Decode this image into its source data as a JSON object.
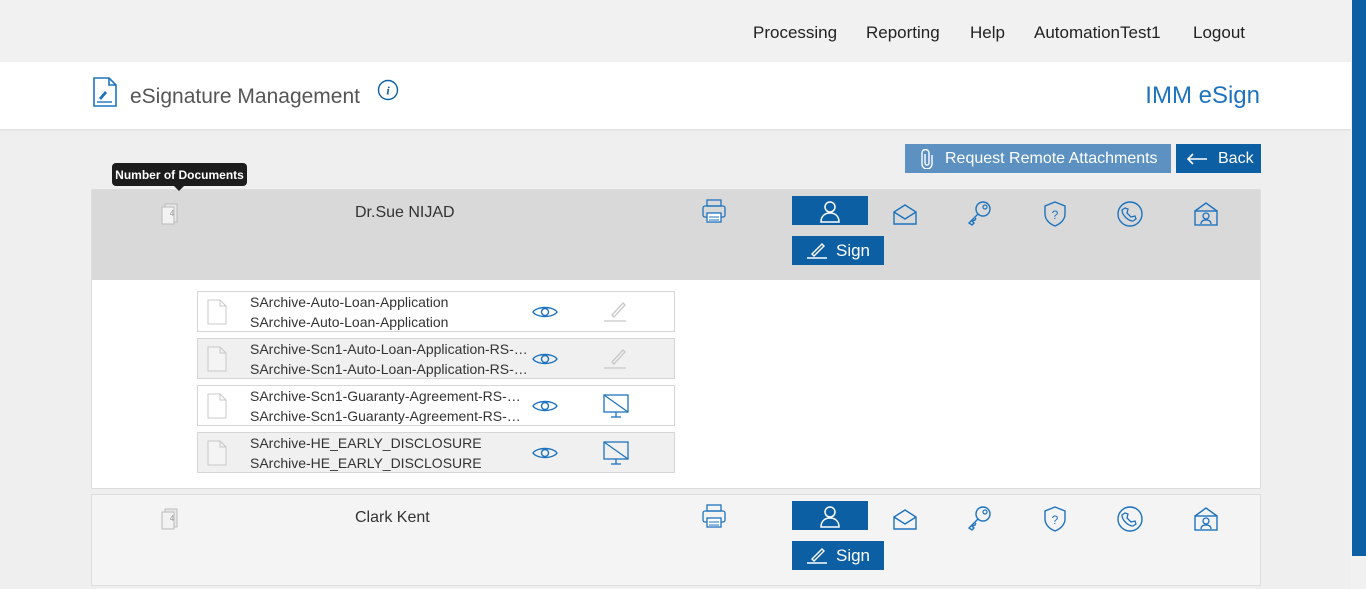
{
  "nav": {
    "items": [
      "Processing",
      "Reporting",
      "Help",
      "AutomationTest1",
      "Logout"
    ]
  },
  "header": {
    "title": "eSignature Management",
    "brand": "IMM eSign"
  },
  "actions": {
    "request_attachments": "Request Remote Attachments",
    "back": "Back"
  },
  "tooltip": "Number of Documents",
  "signers": [
    {
      "name": "Dr.Sue NIJAD",
      "doc_count": "4",
      "sign_label": "Sign",
      "documents": [
        {
          "name1": "SArchive-Auto-Loan-Application",
          "name2": "SArchive-Auto-Loan-Application",
          "action_icon": "pen-icon"
        },
        {
          "name1": "SArchive-Scn1-Auto-Loan-Application-RS-A...",
          "name2": "SArchive-Scn1-Auto-Loan-Application-RS-A...",
          "action_icon": "pen-icon"
        },
        {
          "name1": "SArchive-Scn1-Guaranty-Agreement-RS-AF...",
          "name2": "SArchive-Scn1-Guaranty-Agreement-RS-AF...",
          "action_icon": "monitor-icon"
        },
        {
          "name1": "SArchive-HE_EARLY_DISCLOSURE",
          "name2": "SArchive-HE_EARLY_DISCLOSURE",
          "action_icon": "monitor-icon"
        }
      ]
    },
    {
      "name": "Clark Kent",
      "doc_count": "4",
      "sign_label": "Sign"
    }
  ],
  "colors": {
    "primary": "#0d5fa4",
    "brand": "#1e73be",
    "muted_button": "#5c91c2"
  }
}
